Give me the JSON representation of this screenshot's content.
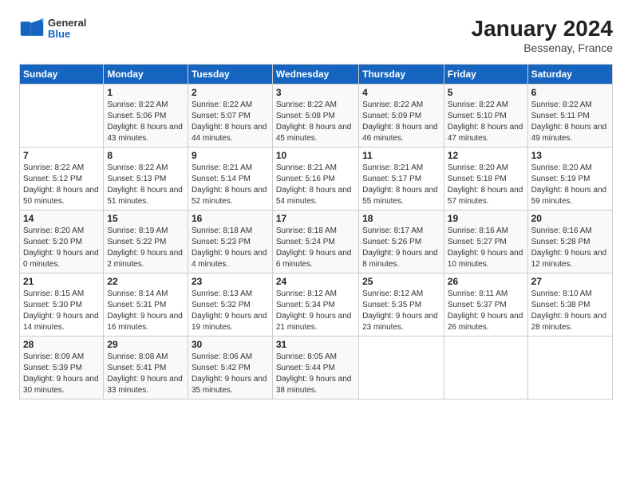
{
  "header": {
    "logo_general": "General",
    "logo_blue": "Blue",
    "title": "January 2024",
    "subtitle": "Bessenay, France"
  },
  "weekdays": [
    "Sunday",
    "Monday",
    "Tuesday",
    "Wednesday",
    "Thursday",
    "Friday",
    "Saturday"
  ],
  "weeks": [
    [
      {
        "day": "",
        "sunrise": "",
        "sunset": "",
        "daylight": ""
      },
      {
        "day": "1",
        "sunrise": "Sunrise: 8:22 AM",
        "sunset": "Sunset: 5:06 PM",
        "daylight": "Daylight: 8 hours and 43 minutes."
      },
      {
        "day": "2",
        "sunrise": "Sunrise: 8:22 AM",
        "sunset": "Sunset: 5:07 PM",
        "daylight": "Daylight: 8 hours and 44 minutes."
      },
      {
        "day": "3",
        "sunrise": "Sunrise: 8:22 AM",
        "sunset": "Sunset: 5:08 PM",
        "daylight": "Daylight: 8 hours and 45 minutes."
      },
      {
        "day": "4",
        "sunrise": "Sunrise: 8:22 AM",
        "sunset": "Sunset: 5:09 PM",
        "daylight": "Daylight: 8 hours and 46 minutes."
      },
      {
        "day": "5",
        "sunrise": "Sunrise: 8:22 AM",
        "sunset": "Sunset: 5:10 PM",
        "daylight": "Daylight: 8 hours and 47 minutes."
      },
      {
        "day": "6",
        "sunrise": "Sunrise: 8:22 AM",
        "sunset": "Sunset: 5:11 PM",
        "daylight": "Daylight: 8 hours and 49 minutes."
      }
    ],
    [
      {
        "day": "7",
        "sunrise": "Sunrise: 8:22 AM",
        "sunset": "Sunset: 5:12 PM",
        "daylight": "Daylight: 8 hours and 50 minutes."
      },
      {
        "day": "8",
        "sunrise": "Sunrise: 8:22 AM",
        "sunset": "Sunset: 5:13 PM",
        "daylight": "Daylight: 8 hours and 51 minutes."
      },
      {
        "day": "9",
        "sunrise": "Sunrise: 8:21 AM",
        "sunset": "Sunset: 5:14 PM",
        "daylight": "Daylight: 8 hours and 52 minutes."
      },
      {
        "day": "10",
        "sunrise": "Sunrise: 8:21 AM",
        "sunset": "Sunset: 5:16 PM",
        "daylight": "Daylight: 8 hours and 54 minutes."
      },
      {
        "day": "11",
        "sunrise": "Sunrise: 8:21 AM",
        "sunset": "Sunset: 5:17 PM",
        "daylight": "Daylight: 8 hours and 55 minutes."
      },
      {
        "day": "12",
        "sunrise": "Sunrise: 8:20 AM",
        "sunset": "Sunset: 5:18 PM",
        "daylight": "Daylight: 8 hours and 57 minutes."
      },
      {
        "day": "13",
        "sunrise": "Sunrise: 8:20 AM",
        "sunset": "Sunset: 5:19 PM",
        "daylight": "Daylight: 8 hours and 59 minutes."
      }
    ],
    [
      {
        "day": "14",
        "sunrise": "Sunrise: 8:20 AM",
        "sunset": "Sunset: 5:20 PM",
        "daylight": "Daylight: 9 hours and 0 minutes."
      },
      {
        "day": "15",
        "sunrise": "Sunrise: 8:19 AM",
        "sunset": "Sunset: 5:22 PM",
        "daylight": "Daylight: 9 hours and 2 minutes."
      },
      {
        "day": "16",
        "sunrise": "Sunrise: 8:18 AM",
        "sunset": "Sunset: 5:23 PM",
        "daylight": "Daylight: 9 hours and 4 minutes."
      },
      {
        "day": "17",
        "sunrise": "Sunrise: 8:18 AM",
        "sunset": "Sunset: 5:24 PM",
        "daylight": "Daylight: 9 hours and 6 minutes."
      },
      {
        "day": "18",
        "sunrise": "Sunrise: 8:17 AM",
        "sunset": "Sunset: 5:26 PM",
        "daylight": "Daylight: 9 hours and 8 minutes."
      },
      {
        "day": "19",
        "sunrise": "Sunrise: 8:16 AM",
        "sunset": "Sunset: 5:27 PM",
        "daylight": "Daylight: 9 hours and 10 minutes."
      },
      {
        "day": "20",
        "sunrise": "Sunrise: 8:16 AM",
        "sunset": "Sunset: 5:28 PM",
        "daylight": "Daylight: 9 hours and 12 minutes."
      }
    ],
    [
      {
        "day": "21",
        "sunrise": "Sunrise: 8:15 AM",
        "sunset": "Sunset: 5:30 PM",
        "daylight": "Daylight: 9 hours and 14 minutes."
      },
      {
        "day": "22",
        "sunrise": "Sunrise: 8:14 AM",
        "sunset": "Sunset: 5:31 PM",
        "daylight": "Daylight: 9 hours and 16 minutes."
      },
      {
        "day": "23",
        "sunrise": "Sunrise: 8:13 AM",
        "sunset": "Sunset: 5:32 PM",
        "daylight": "Daylight: 9 hours and 19 minutes."
      },
      {
        "day": "24",
        "sunrise": "Sunrise: 8:12 AM",
        "sunset": "Sunset: 5:34 PM",
        "daylight": "Daylight: 9 hours and 21 minutes."
      },
      {
        "day": "25",
        "sunrise": "Sunrise: 8:12 AM",
        "sunset": "Sunset: 5:35 PM",
        "daylight": "Daylight: 9 hours and 23 minutes."
      },
      {
        "day": "26",
        "sunrise": "Sunrise: 8:11 AM",
        "sunset": "Sunset: 5:37 PM",
        "daylight": "Daylight: 9 hours and 26 minutes."
      },
      {
        "day": "27",
        "sunrise": "Sunrise: 8:10 AM",
        "sunset": "Sunset: 5:38 PM",
        "daylight": "Daylight: 9 hours and 28 minutes."
      }
    ],
    [
      {
        "day": "28",
        "sunrise": "Sunrise: 8:09 AM",
        "sunset": "Sunset: 5:39 PM",
        "daylight": "Daylight: 9 hours and 30 minutes."
      },
      {
        "day": "29",
        "sunrise": "Sunrise: 8:08 AM",
        "sunset": "Sunset: 5:41 PM",
        "daylight": "Daylight: 9 hours and 33 minutes."
      },
      {
        "day": "30",
        "sunrise": "Sunrise: 8:06 AM",
        "sunset": "Sunset: 5:42 PM",
        "daylight": "Daylight: 9 hours and 35 minutes."
      },
      {
        "day": "31",
        "sunrise": "Sunrise: 8:05 AM",
        "sunset": "Sunset: 5:44 PM",
        "daylight": "Daylight: 9 hours and 38 minutes."
      },
      {
        "day": "",
        "sunrise": "",
        "sunset": "",
        "daylight": ""
      },
      {
        "day": "",
        "sunrise": "",
        "sunset": "",
        "daylight": ""
      },
      {
        "day": "",
        "sunrise": "",
        "sunset": "",
        "daylight": ""
      }
    ]
  ]
}
